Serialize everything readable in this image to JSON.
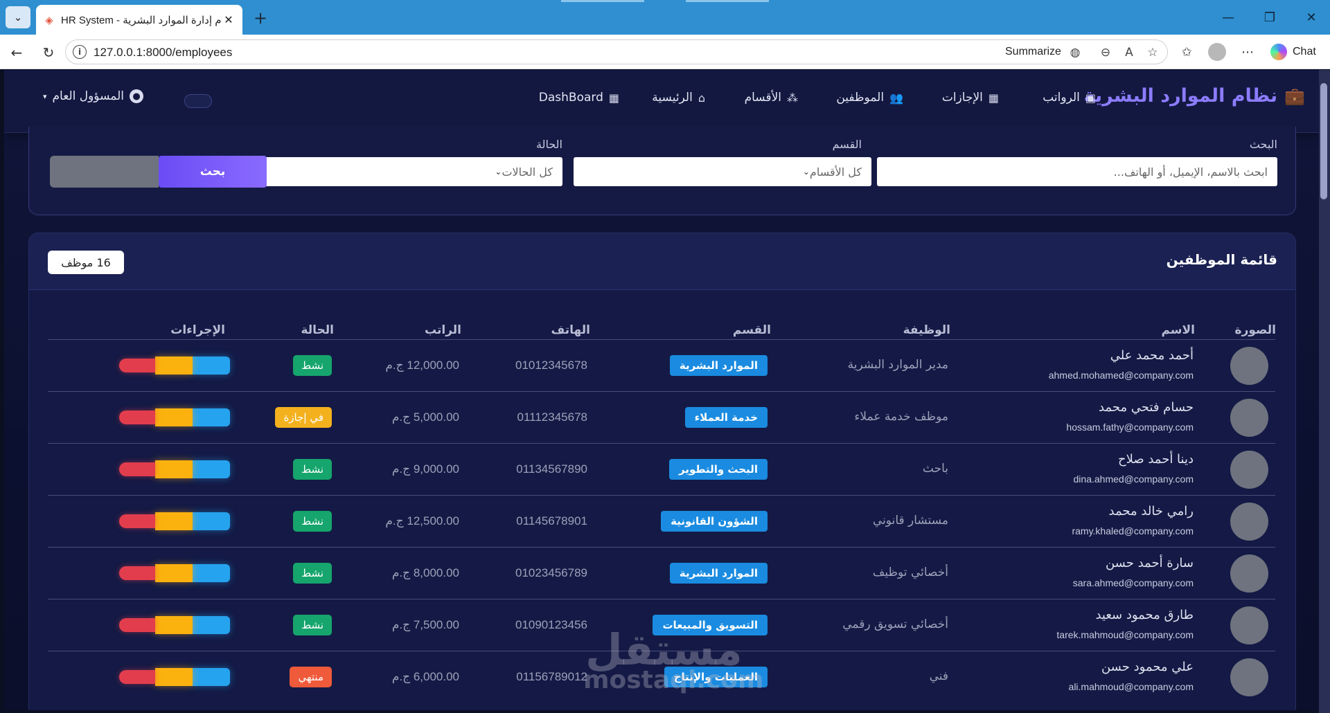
{
  "browser": {
    "tab_title": "HR System - نظام إدارة الموارد البشرية",
    "url": "127.0.0.1:8000/employees",
    "summarize_label": "Summarize",
    "chat_label": "Chat"
  },
  "nav": {
    "brand": "نظام الموارد البشرية",
    "items": [
      "الرواتب",
      "الإجازات",
      "الموظفين",
      "الأقسام",
      "الرئيسية",
      "DashBoard"
    ],
    "user": "المسؤول العام"
  },
  "filters": {
    "search_label": "البحث",
    "search_placeholder": "ابحث بالاسم، الإيميل، أو الهاتف...",
    "dept_label": "القسم",
    "dept_value": "كل الأقسام",
    "status_label": "الحالة",
    "status_value": "كل الحالات",
    "search_button": "بحث"
  },
  "employees": {
    "title": "قائمة الموظفين",
    "count_badge": "16 موظف",
    "columns": [
      "الصورة",
      "الاسم",
      "الوظيفة",
      "القسم",
      "الهاتف",
      "الراتب",
      "الحالة",
      "الإجراءات"
    ],
    "rows": [
      {
        "name": "أحمد محمد علي",
        "email": "ahmed.mohamed@company.com",
        "job": "مدير الموارد البشرية",
        "dept": "الموارد البشرية",
        "phone": "01012345678",
        "salary": "12,000.00 ج.م",
        "status": "نشط"
      },
      {
        "name": "حسام فتحي محمد",
        "email": "hossam.fathy@company.com",
        "job": "موظف خدمة عملاء",
        "dept": "خدمة العملاء",
        "phone": "01112345678",
        "salary": "5,000.00 ج.م",
        "status": "في إجازة"
      },
      {
        "name": "دينا أحمد صلاح",
        "email": "dina.ahmed@company.com",
        "job": "باحث",
        "dept": "البحث والتطوير",
        "phone": "01134567890",
        "salary": "9,000.00 ج.م",
        "status": "نشط"
      },
      {
        "name": "رامي خالد محمد",
        "email": "ramy.khaled@company.com",
        "job": "مستشار قانوني",
        "dept": "الشؤون القانونية",
        "phone": "01145678901",
        "salary": "12,500.00 ج.م",
        "status": "نشط"
      },
      {
        "name": "سارة أحمد حسن",
        "email": "sara.ahmed@company.com",
        "job": "أخصائي توظيف",
        "dept": "الموارد البشرية",
        "phone": "01023456789",
        "salary": "8,000.00 ج.م",
        "status": "نشط"
      },
      {
        "name": "طارق محمود سعيد",
        "email": "tarek.mahmoud@company.com",
        "job": "أخصائي تسويق رقمي",
        "dept": "التسويق والمبيعات",
        "phone": "01090123456",
        "salary": "7,500.00 ج.م",
        "status": "نشط"
      },
      {
        "name": "علي محمود حسن",
        "email": "ali.mahmoud@company.com",
        "job": "فني",
        "dept": "العمليات والإنتاج",
        "phone": "01156789012",
        "salary": "6,000.00 ج.م",
        "status": "منتهي"
      }
    ]
  },
  "watermark": {
    "arabic": "مستقل",
    "latin": "mostaql.com"
  },
  "colors": {
    "brand": "#8c7cff",
    "active": "#16a56c",
    "leave": "#f4b11e",
    "ended": "#ef5a3a",
    "dept": "#1a8be0"
  }
}
